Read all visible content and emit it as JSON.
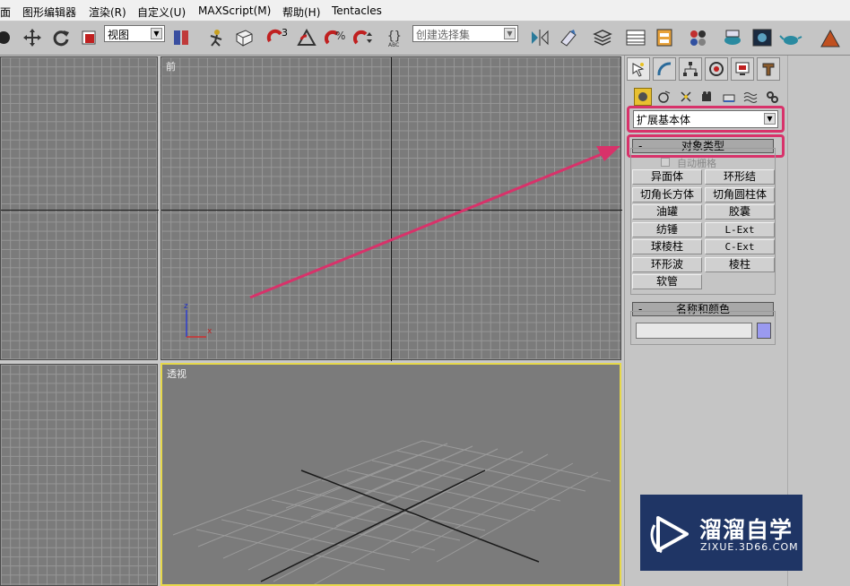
{
  "menu": [
    "面",
    "图形编辑器",
    "渲染(R)",
    "自定义(U)",
    "MAXScript(M)",
    "帮助(H)",
    "Tentacles"
  ],
  "toolbar": {
    "view_select": "视图",
    "selection_set_placeholder": "创建选择集",
    "snap_angle_label": "3"
  },
  "viewports": {
    "front": "前",
    "perspective": "透视",
    "axis_z": "z",
    "axis_x": "x"
  },
  "command_panel": {
    "category_dropdown": "扩展基本体",
    "object_type": {
      "header": "对象类型",
      "collapse_symbol": "-",
      "autogrid_label": "自动栅格",
      "buttons": [
        "异面体",
        "环形结",
        "切角长方体",
        "切角圆柱体",
        "油罐",
        "胶囊",
        "纺锤",
        "L-Ext",
        "球棱柱",
        "C-Ext",
        "环形波",
        "棱柱",
        "软管"
      ]
    },
    "name_color": {
      "header": "名称和颜色",
      "collapse_symbol": "-",
      "name_value": ""
    }
  },
  "colors": {
    "highlight": "#d8326a",
    "active_viewport_border": "#e6d84a",
    "object_color_swatch": "#9a9af0",
    "logo_background": "#1f3565"
  },
  "watermark": {
    "title": "溜溜自学",
    "url": "ZIXUE.3D66.COM"
  }
}
